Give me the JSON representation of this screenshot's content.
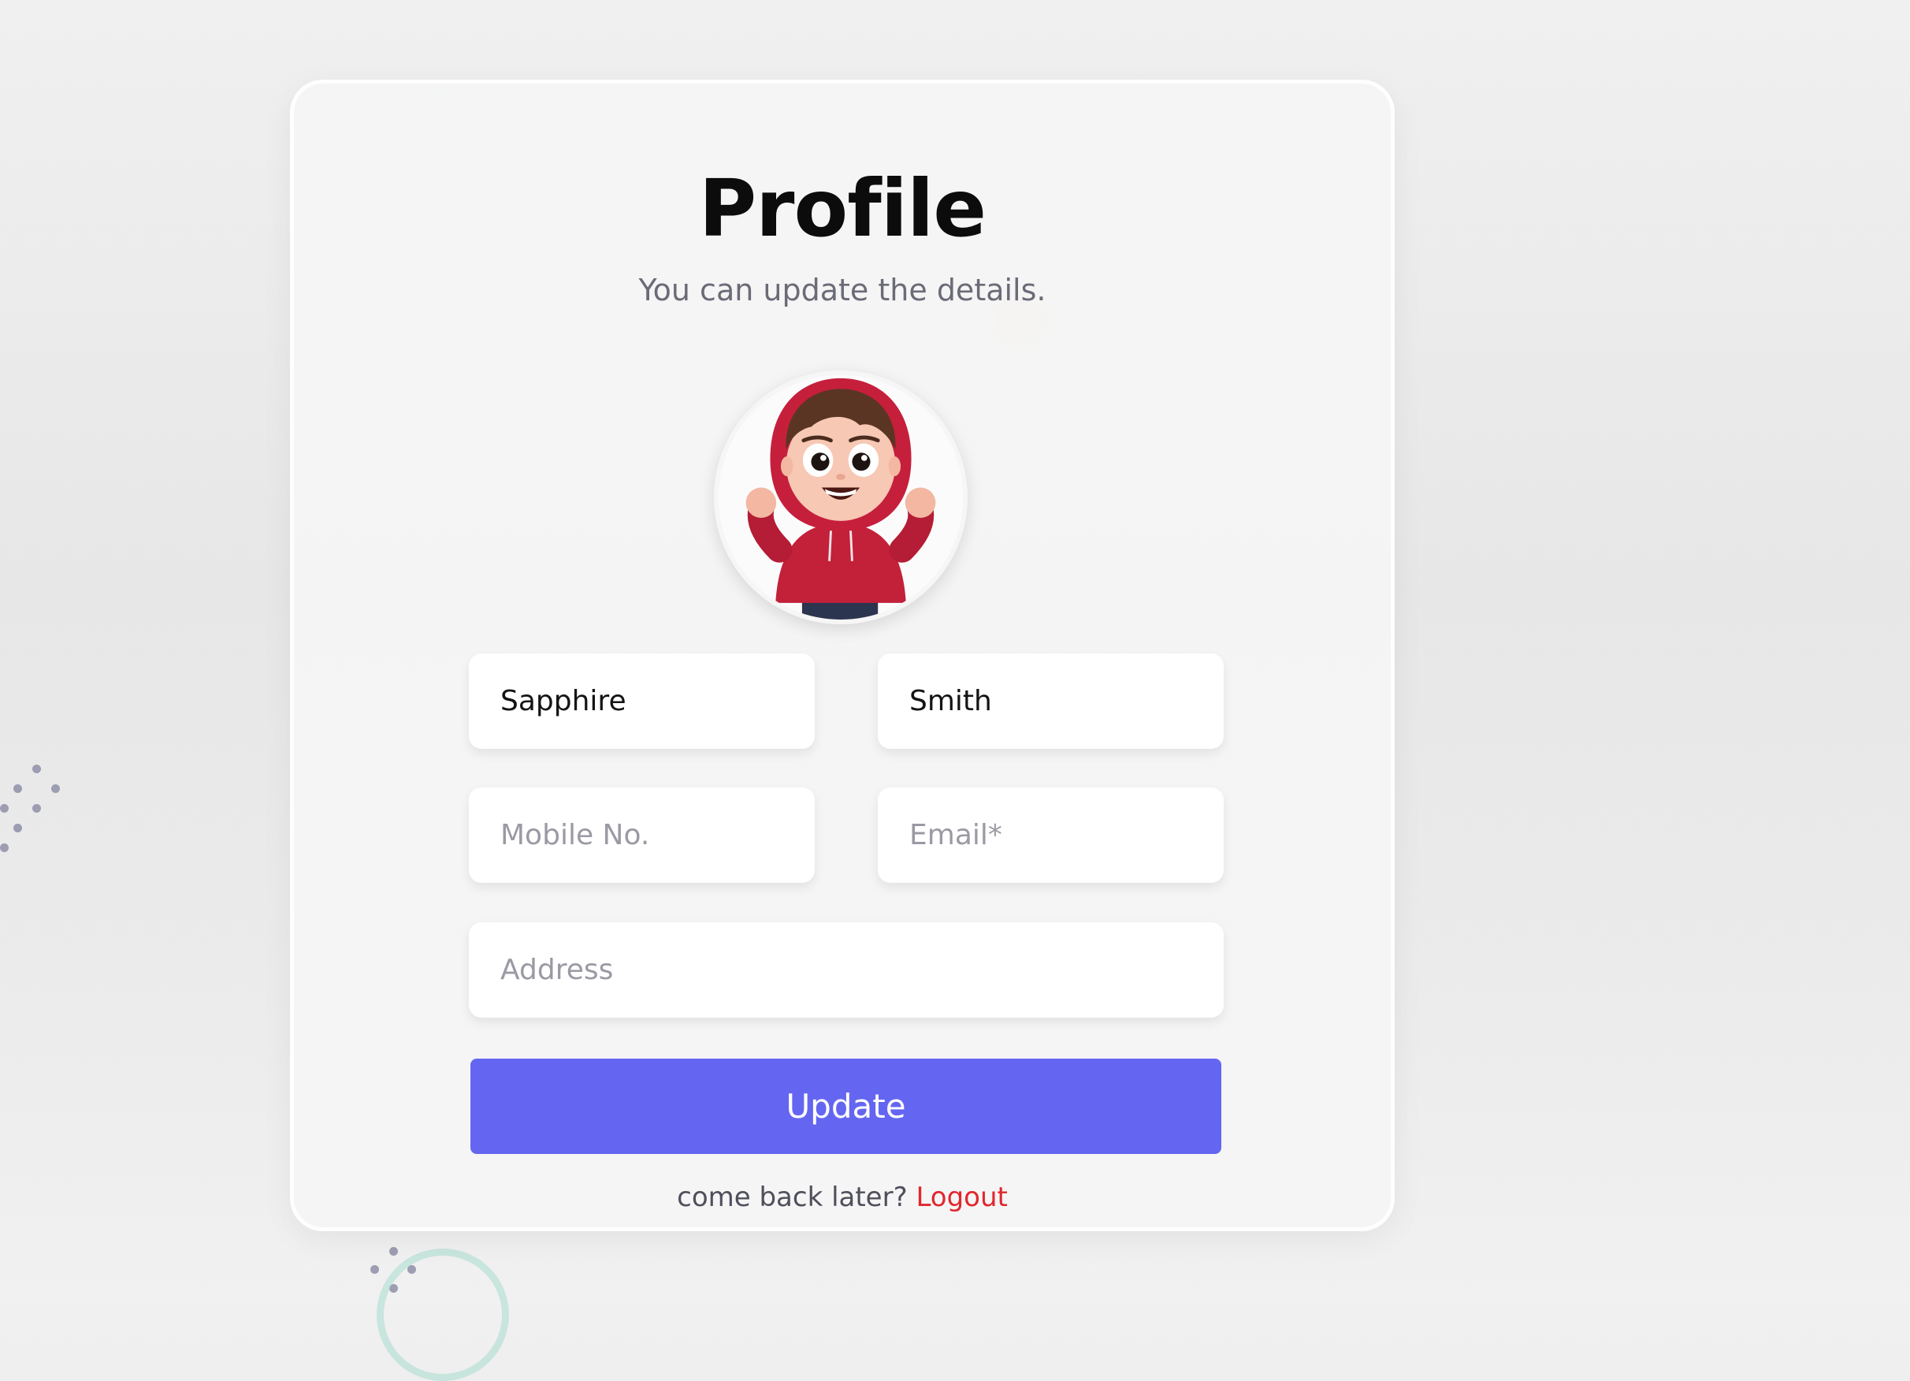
{
  "profile": {
    "title": "Profile",
    "subtitle": "You can update the details.",
    "avatar_icon": "avatar-cartoon-boy-red-hoodie",
    "fields": {
      "first_name": {
        "value": "Sapphire",
        "placeholder": ""
      },
      "last_name": {
        "value": "Smith",
        "placeholder": ""
      },
      "mobile": {
        "value": "",
        "placeholder": "Mobile No."
      },
      "email": {
        "value": "",
        "placeholder": "Email*"
      },
      "address": {
        "value": "",
        "placeholder": "Address"
      }
    },
    "update_label": "Update",
    "footer_text": "come back later?",
    "logout_label": "Logout"
  },
  "colors": {
    "primary": "#6466f1",
    "logout": "#e1262e",
    "title": "#0c0c0c",
    "subtitle": "#6b6b78"
  }
}
